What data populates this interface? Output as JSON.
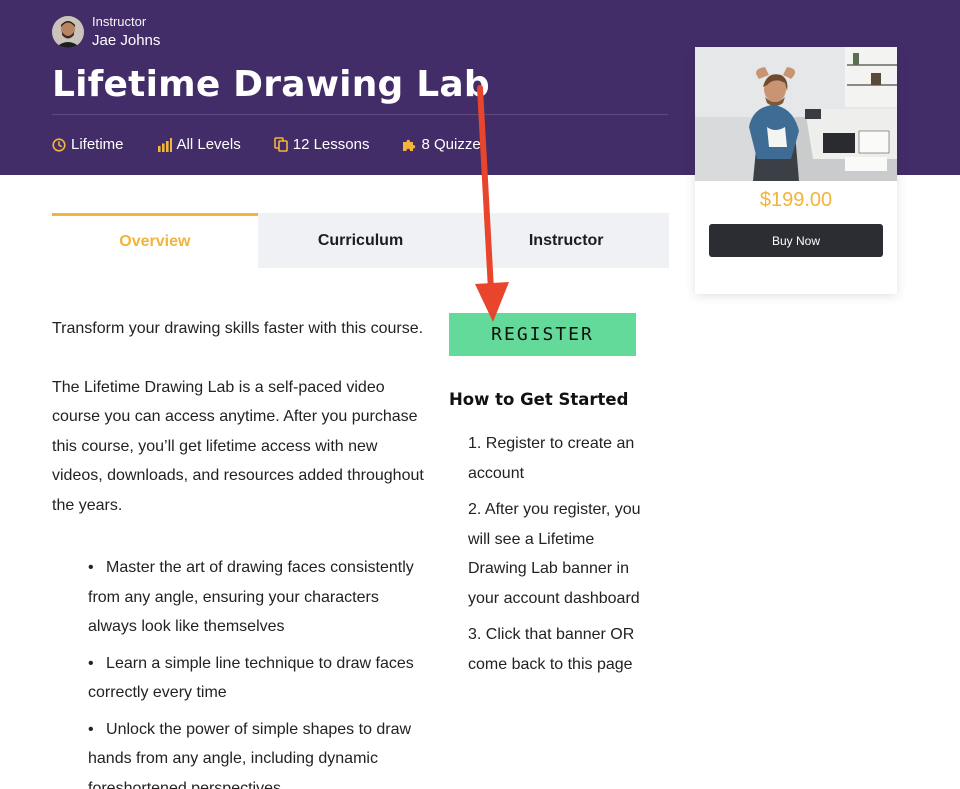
{
  "header": {
    "instructor_role": "Instructor",
    "instructor_name": "Jae Johns",
    "course_title": "Lifetime Drawing Lab",
    "meta": [
      {
        "icon": "clock-icon",
        "label": "Lifetime"
      },
      {
        "icon": "bar-chart-icon",
        "label": "All Levels"
      },
      {
        "icon": "copy-icon",
        "label": "12 Lessons"
      },
      {
        "icon": "puzzle-icon",
        "label": "8 Quizze"
      }
    ]
  },
  "card": {
    "price": "$199.00",
    "buy_label": "Buy Now"
  },
  "tabs": [
    {
      "label": "Overview",
      "active": true
    },
    {
      "label": "Curriculum",
      "active": false
    },
    {
      "label": "Instructor",
      "active": false
    }
  ],
  "content": {
    "intro": "Transform your drawing skills faster with this course.",
    "description": "The Lifetime Drawing Lab is a self-paced video course you can access anytime. After you purchase this course, you’ll get lifetime access with new videos, downloads, and resources added throughout the years.",
    "bullets": [
      "Master the art of drawing faces consistently from any angle, ensuring your characters always look like themselves",
      "Learn a simple line technique to draw faces correctly every time",
      "Unlock the power of simple shapes to draw hands from any angle, including dynamic foreshortened perspectives"
    ]
  },
  "register": {
    "button_label": "REGISTER",
    "title": "How to Get Started",
    "steps": [
      "1. Register to create an account",
      "2. After you register, you will see a Lifetime Drawing Lab banner in your account dashboard",
      "3. Click that banner OR come back to this page"
    ]
  },
  "colors": {
    "hero_bg": "#432d68",
    "accent": "#f2b43a",
    "register_bg": "#63d99a",
    "buy_bg": "#2b2d33",
    "arrow": "#e8452c"
  }
}
